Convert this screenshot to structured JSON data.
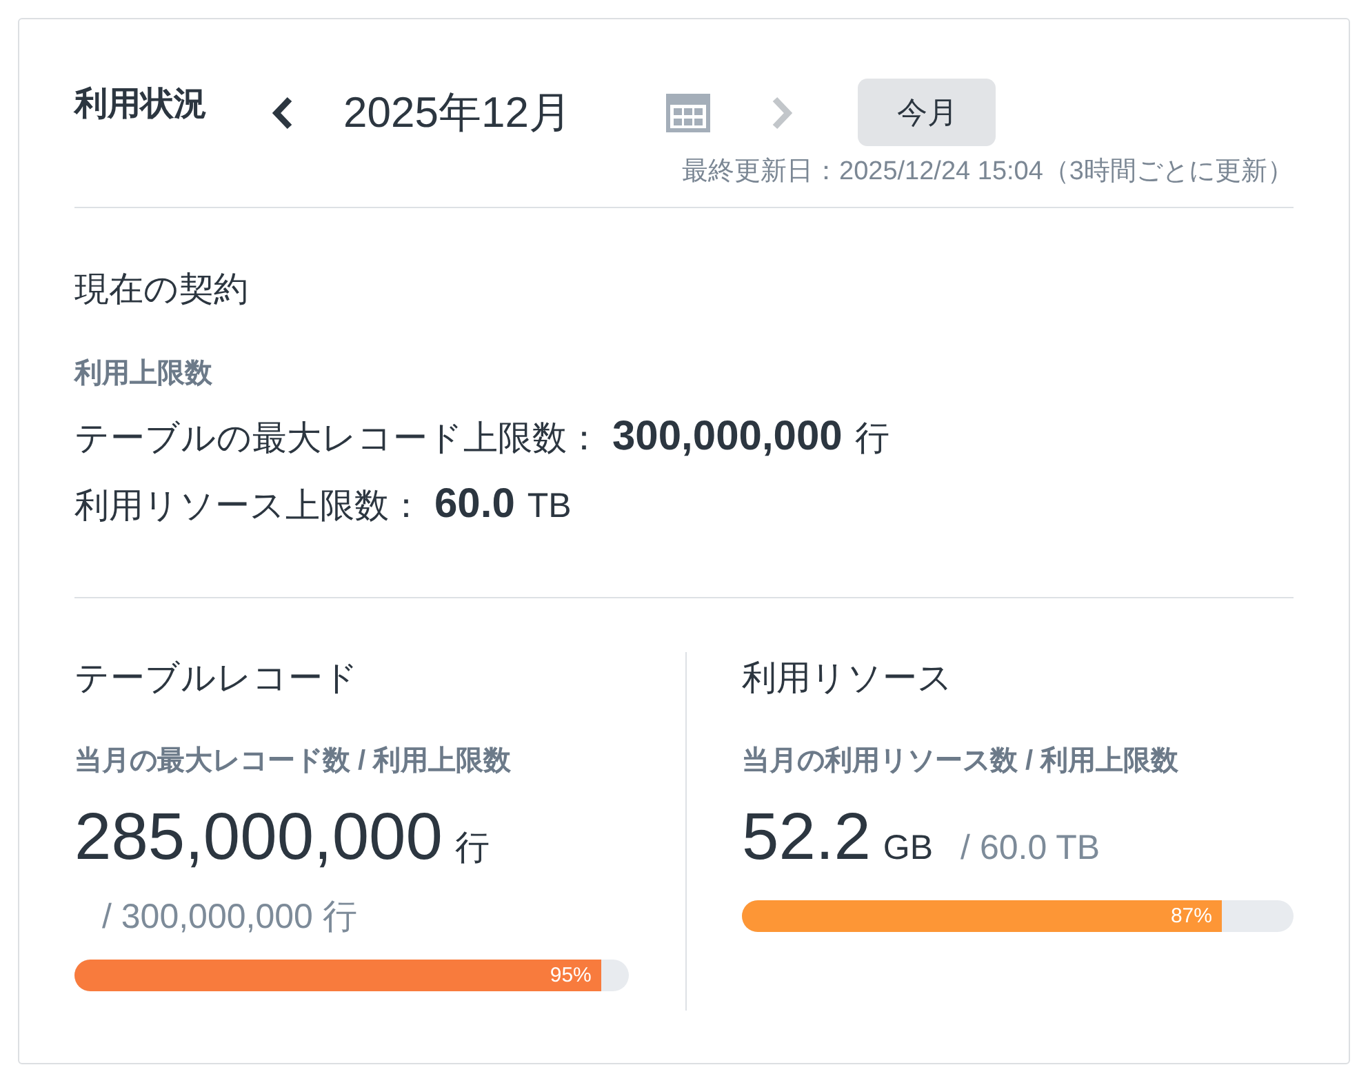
{
  "header": {
    "title": "利用状況",
    "prev_month": {
      "disabled": false
    },
    "month": "2025年12月",
    "next_month": {
      "disabled": true
    },
    "today_button": "今月",
    "last_updated": "最終更新日：2025/12/24 15:04（3時間ごとに更新）"
  },
  "contract": {
    "heading": "現在の契約",
    "subheading": "利用上限数",
    "limits": [
      {
        "label": "テーブルの最大レコード上限数：",
        "value": "300,000,000",
        "unit": "行"
      },
      {
        "label": "利用リソース上限数：",
        "value": "60.0",
        "unit": "TB"
      }
    ]
  },
  "usage": [
    {
      "title": "テーブルレコード",
      "caption": "当月の最大レコード数 / 利用上限数",
      "value": "285,000,000",
      "unit": "行",
      "limit": "/ 300,000,000 行",
      "meter": {
        "level": 0.95,
        "label": "95%"
      }
    },
    {
      "title": "利用リソース",
      "caption": "当月の利用リソース数 / 利用上限数",
      "value": "52.2",
      "unit": "GB",
      "limit": "/ 60.0 TB",
      "meter": {
        "level": 0.87,
        "label": "87%"
      }
    }
  ]
}
